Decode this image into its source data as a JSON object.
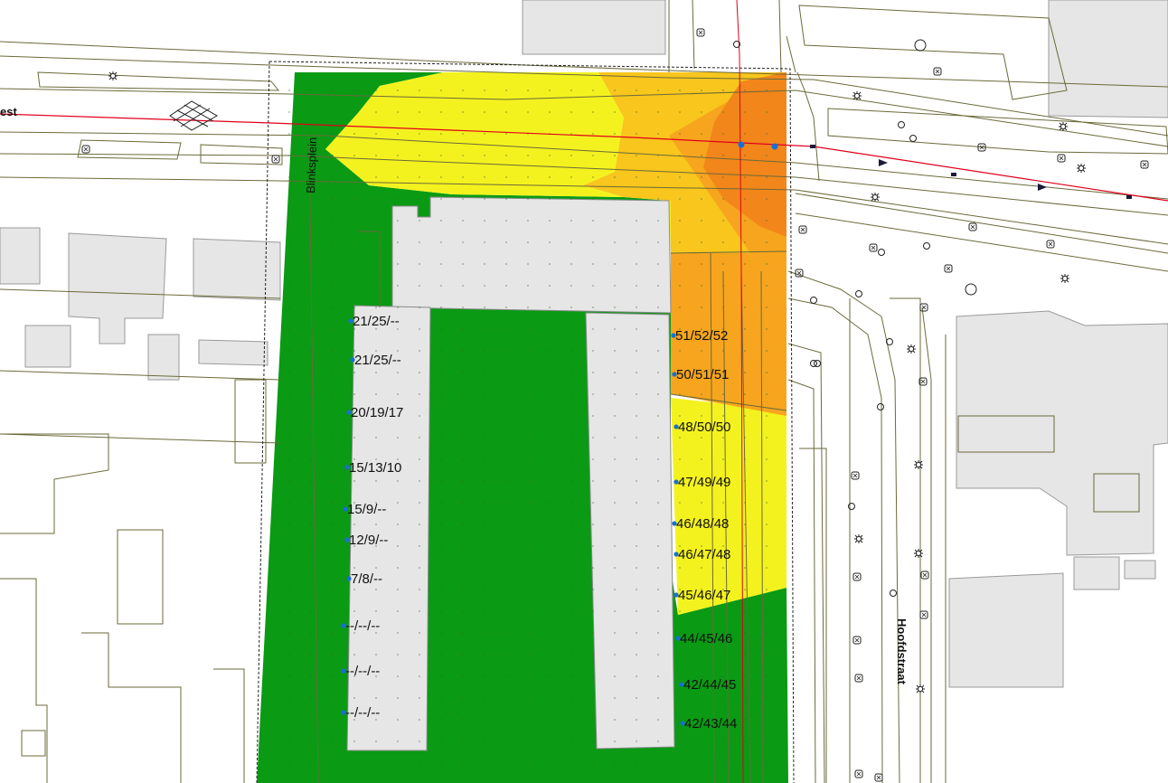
{
  "map": {
    "streets": {
      "west_square": "Blinksplein",
      "east_street": "Hoofdstraat",
      "top_left_fragment": "est"
    },
    "colors": {
      "zone_green": "#0a9a14",
      "zone_yellow": "#f4f21e",
      "zone_light_orange": "#f8c61c",
      "zone_orange": "#f7a51e",
      "zone_dark_orange": "#f2861a",
      "building_fill": "#e6e6e6",
      "cadastre_line": "#6b6a3a",
      "calc_point": "#1a6fd6",
      "road_axis": "#e0001b"
    },
    "receiver_points": [
      {
        "label": "21/25/--",
        "side": "west"
      },
      {
        "label": "21/25/--",
        "side": "west"
      },
      {
        "label": "20/19/17",
        "side": "west"
      },
      {
        "label": "15/13/10",
        "side": "west"
      },
      {
        "label": "15/9/--",
        "side": "west"
      },
      {
        "label": "12/9/--",
        "side": "west"
      },
      {
        "label": "7/8/--",
        "side": "west"
      },
      {
        "label": "--/--/--",
        "side": "west"
      },
      {
        "label": "--/--/--",
        "side": "west"
      },
      {
        "label": "--/--/--",
        "side": "west"
      },
      {
        "label": "51/52/52",
        "side": "east"
      },
      {
        "label": "50/51/51",
        "side": "east"
      },
      {
        "label": "48/50/50",
        "side": "east"
      },
      {
        "label": "47/49/49",
        "side": "east"
      },
      {
        "label": "46/48/48",
        "side": "east"
      },
      {
        "label": "46/47/48",
        "side": "east"
      },
      {
        "label": "45/46/47",
        "side": "east"
      },
      {
        "label": "44/45/46",
        "side": "east"
      },
      {
        "label": "42/44/45",
        "side": "east"
      },
      {
        "label": "42/43/44",
        "side": "east"
      }
    ]
  }
}
